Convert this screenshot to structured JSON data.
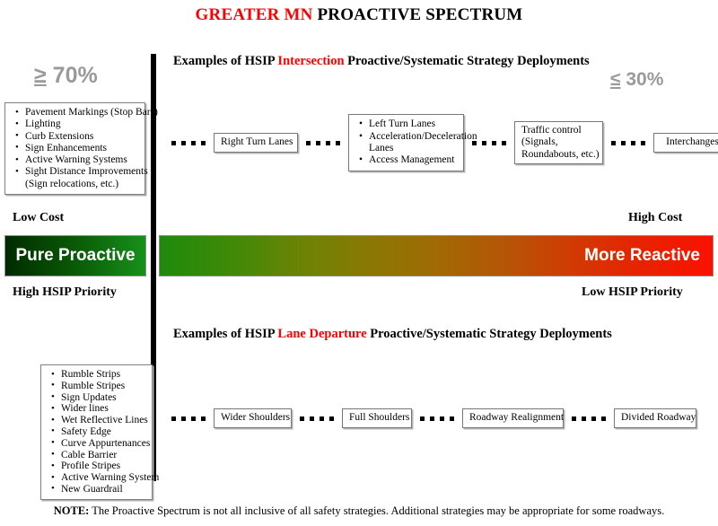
{
  "title": {
    "highlight": "GREATER MN",
    "rest": " PROACTIVE SPECTRUM"
  },
  "colors": {
    "accent_red": "#ff0000",
    "percent_gray": "#9a9a9a",
    "proactive_green_dark": "#002b00",
    "proactive_green_light": "#17911a",
    "spectrum_start": "#1f8a0c",
    "spectrum_mid": "#a06a04",
    "spectrum_end": "#fa1200"
  },
  "percentages": {
    "left_operator": "≥",
    "left_value": " 70%",
    "right_operator": "≤",
    "right_value": " 30%"
  },
  "sections": {
    "intersection": {
      "heading_prefix": "Examples of HSIP ",
      "heading_highlight": "Intersection",
      "heading_suffix": " Proactive/Systematic Strategy Deployments"
    },
    "lane_departure": {
      "heading_prefix": "Examples of HSIP ",
      "heading_highlight": "Lane Departure",
      "heading_suffix": " Proactive/Systematic Strategy Deployments"
    }
  },
  "proactive_lists": {
    "intersection": [
      "Pavement Markings (Stop Bars)",
      "Lighting",
      "Curb Extensions",
      "Sign Enhancements",
      "Active Warning Systems",
      "Sight Distance Improvements",
      "(Sign relocations, etc.)"
    ],
    "lane_departure": [
      "Rumble Strips",
      "Rumble Stripes",
      "Sign Updates",
      "Wider lines",
      "Wet Reflective Lines",
      "Safety Edge",
      "Curve Appurtenances",
      "Cable Barrier",
      "Profile Stripes",
      "Active Warning System",
      "New Guardrail"
    ]
  },
  "spectrum": {
    "low_cost_label": "Low Cost",
    "high_cost_label": "High Cost",
    "high_priority_label": "High HSIP Priority",
    "low_priority_label": "Low HSIP Priority",
    "pure_proactive_label": "Pure Proactive",
    "more_reactive_label": "More Reactive"
  },
  "flow_intersection": {
    "box1": "Right Turn Lanes",
    "box2_items": [
      "Left Turn Lanes",
      "Acceleration/Deceleration",
      "Lanes",
      "Access Management"
    ],
    "box3_line1": "Traffic control",
    "box3_line2": "(Signals,",
    "box3_line3": "Roundabouts, etc.)",
    "box4": "Interchanges"
  },
  "flow_lane_departure": {
    "box1": "Wider Shoulders",
    "box2": "Full Shoulders",
    "box3": "Roadway Realignment",
    "box4": "Divided Roadway"
  },
  "footer": {
    "label": "NOTE:",
    "text": " The Proactive Spectrum is not all inclusive of all safety strategies.  Additional strategies may be appropriate for some roadways."
  }
}
